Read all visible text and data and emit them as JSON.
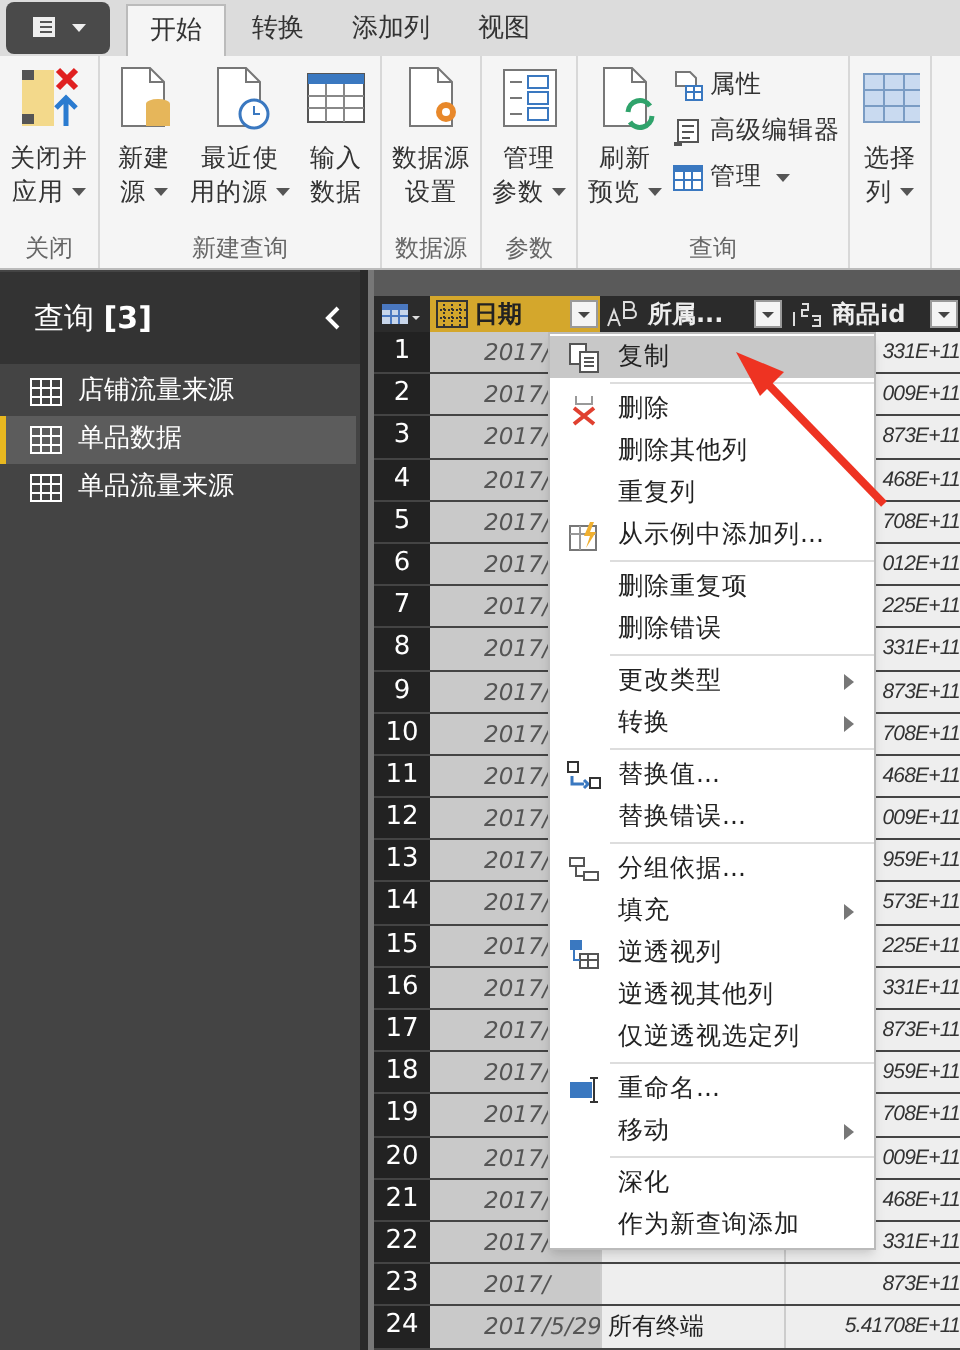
{
  "tabs": [
    {
      "label": "开始",
      "selected": true
    },
    {
      "label": "转换",
      "selected": false
    },
    {
      "label": "添加列",
      "selected": false
    },
    {
      "label": "视图",
      "selected": false
    }
  ],
  "ribbon": {
    "groups": [
      {
        "label": "关闭",
        "buttons": [
          {
            "kind": "large",
            "lines": [
              "关闭并",
              "应用"
            ],
            "dropdown": true
          }
        ]
      },
      {
        "label": "新建查询",
        "buttons": [
          {
            "kind": "large",
            "lines": [
              "新建",
              "源"
            ],
            "dropdown": true
          },
          {
            "kind": "large",
            "lines": [
              "最近使",
              "用的源"
            ],
            "dropdown": true
          },
          {
            "kind": "large",
            "lines": [
              "输入",
              "数据"
            ],
            "dropdown": false
          }
        ]
      },
      {
        "label": "数据源",
        "buttons": [
          {
            "kind": "large",
            "lines": [
              "数据源",
              "设置"
            ],
            "dropdown": false
          }
        ]
      },
      {
        "label": "参数",
        "buttons": [
          {
            "kind": "large",
            "lines": [
              "管理",
              "参数"
            ],
            "dropdown": true
          }
        ]
      },
      {
        "label": "查询",
        "buttons": [
          {
            "kind": "large",
            "lines": [
              "刷新",
              "预览"
            ],
            "dropdown": true
          },
          {
            "kind": "small",
            "lines": [
              "属性"
            ],
            "dropdown": false
          },
          {
            "kind": "small",
            "lines": [
              "高级编辑器"
            ],
            "dropdown": false
          },
          {
            "kind": "small",
            "lines": [
              "管理"
            ],
            "dropdown": true
          }
        ]
      },
      {
        "buttons": [
          {
            "kind": "large",
            "lines": [
              "选择",
              "列"
            ],
            "dropdown": true
          }
        ]
      }
    ]
  },
  "queries": {
    "title": "查询",
    "count": "[3]",
    "items": [
      {
        "label": "店铺流量来源",
        "selected": false
      },
      {
        "label": "单品数据",
        "selected": true
      },
      {
        "label": "单品流量来源",
        "selected": false
      }
    ]
  },
  "table": {
    "columns": [
      {
        "label": "日期",
        "selected": true
      },
      {
        "label": "所属...",
        "selected": false
      },
      {
        "label": "商品id",
        "selected": false
      }
    ],
    "rows": [
      {
        "number": "1",
        "date": "2017/",
        "id": "331E+11"
      },
      {
        "number": "2",
        "date": "2017/",
        "id": "009E+11"
      },
      {
        "number": "3",
        "date": "2017/",
        "id": "873E+11"
      },
      {
        "number": "4",
        "date": "2017/",
        "id": "468E+11"
      },
      {
        "number": "5",
        "date": "2017/",
        "id": "708E+11"
      },
      {
        "number": "6",
        "date": "2017/",
        "id": "012E+11"
      },
      {
        "number": "7",
        "date": "2017/",
        "id": "225E+11"
      },
      {
        "number": "8",
        "date": "2017/",
        "id": "331E+11"
      },
      {
        "number": "9",
        "date": "2017/",
        "id": "873E+11"
      },
      {
        "number": "10",
        "date": "2017/",
        "id": "708E+11"
      },
      {
        "number": "11",
        "date": "2017/",
        "id": "468E+11"
      },
      {
        "number": "12",
        "date": "2017/",
        "id": "009E+11"
      },
      {
        "number": "13",
        "date": "2017/",
        "id": "959E+11"
      },
      {
        "number": "14",
        "date": "2017/",
        "id": "573E+11"
      },
      {
        "number": "15",
        "date": "2017/",
        "id": "225E+11"
      },
      {
        "number": "16",
        "date": "2017/",
        "id": "331E+11"
      },
      {
        "number": "17",
        "date": "2017/",
        "id": "873E+11"
      },
      {
        "number": "18",
        "date": "2017/",
        "id": "959E+11"
      },
      {
        "number": "19",
        "date": "2017/",
        "id": "708E+11"
      },
      {
        "number": "20",
        "date": "2017/",
        "id": "009E+11"
      },
      {
        "number": "21",
        "date": "2017/",
        "id": "468E+11"
      },
      {
        "number": "22",
        "date": "2017/",
        "id": "331E+11"
      },
      {
        "number": "23",
        "date": "2017/",
        "id": "873E+11"
      },
      {
        "number": "24",
        "date": "2017/5/29",
        "source": "所有终端",
        "id": "5.41708E+11"
      }
    ]
  },
  "context_menu": {
    "sections": [
      [
        {
          "label": "复制",
          "submenu": false,
          "selected": true
        }
      ],
      [
        {
          "label": "删除",
          "submenu": false,
          "selected": false
        },
        {
          "label": "删除其他列",
          "submenu": false,
          "selected": false
        },
        {
          "label": "重复列",
          "submenu": false,
          "selected": false
        },
        {
          "label": "从示例中添加列...",
          "submenu": false,
          "selected": false
        }
      ],
      [
        {
          "label": "删除重复项",
          "submenu": false,
          "selected": false
        },
        {
          "label": "删除错误",
          "submenu": false,
          "selected": false
        }
      ],
      [
        {
          "label": "更改类型",
          "submenu": true,
          "selected": false
        },
        {
          "label": "转换",
          "submenu": true,
          "selected": false
        }
      ],
      [
        {
          "label": "替换值...",
          "submenu": false,
          "selected": false
        },
        {
          "label": "替换错误...",
          "submenu": false,
          "selected": false
        }
      ],
      [
        {
          "label": "分组依据...",
          "submenu": false,
          "selected": false
        },
        {
          "label": "填充",
          "submenu": true,
          "selected": false
        },
        {
          "label": "逆透视列",
          "submenu": false,
          "selected": false
        },
        {
          "label": "逆透视其他列",
          "submenu": false,
          "selected": false
        },
        {
          "label": "仅逆透视选定列",
          "submenu": false,
          "selected": false
        }
      ],
      [
        {
          "label": "重命名...",
          "submenu": false,
          "selected": false
        },
        {
          "label": "移动",
          "submenu": true,
          "selected": false
        }
      ],
      [
        {
          "label": "深化",
          "submenu": false,
          "selected": false
        },
        {
          "label": "作为新查询添加",
          "submenu": false,
          "selected": false
        }
      ]
    ]
  }
}
